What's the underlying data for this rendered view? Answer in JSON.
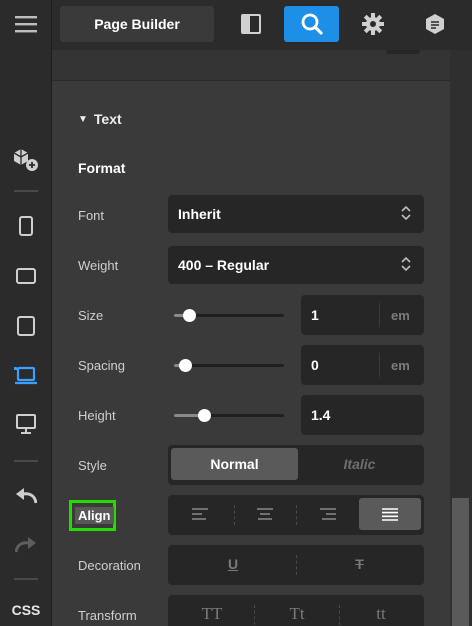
{
  "topbar": {
    "title": "Page Builder",
    "icons": [
      "layout-panel-icon",
      "search-icon",
      "gear-icon",
      "document-hexagon-icon"
    ],
    "accent": "#1e8fe6"
  },
  "rail": {
    "bottom_label": "CSS",
    "active_color": "#3aa0ff"
  },
  "section": {
    "title": "Text",
    "subtitle": "Format"
  },
  "rows": {
    "font": {
      "label": "Font",
      "value": "Inherit"
    },
    "weight": {
      "label": "Weight",
      "value": "400 – Regular"
    },
    "size": {
      "label": "Size",
      "value": "1",
      "unit": "em",
      "slider": 0.14
    },
    "spacing": {
      "label": "Spacing",
      "value": "0",
      "unit": "em",
      "slider": 0.1
    },
    "height": {
      "label": "Height",
      "value": "1.4",
      "slider": 0.27
    },
    "style": {
      "label": "Style",
      "options": [
        "Normal",
        "Italic"
      ],
      "selected": "Normal"
    },
    "align": {
      "label": "Align",
      "options": [
        "left",
        "center",
        "right",
        "justify"
      ],
      "selected": "justify",
      "highlight": "#22dd00"
    },
    "decoration": {
      "label": "Decoration",
      "options": [
        "U",
        "T"
      ]
    },
    "transform": {
      "label": "Transform",
      "options": [
        "TT",
        "Tt",
        "tt"
      ]
    }
  }
}
